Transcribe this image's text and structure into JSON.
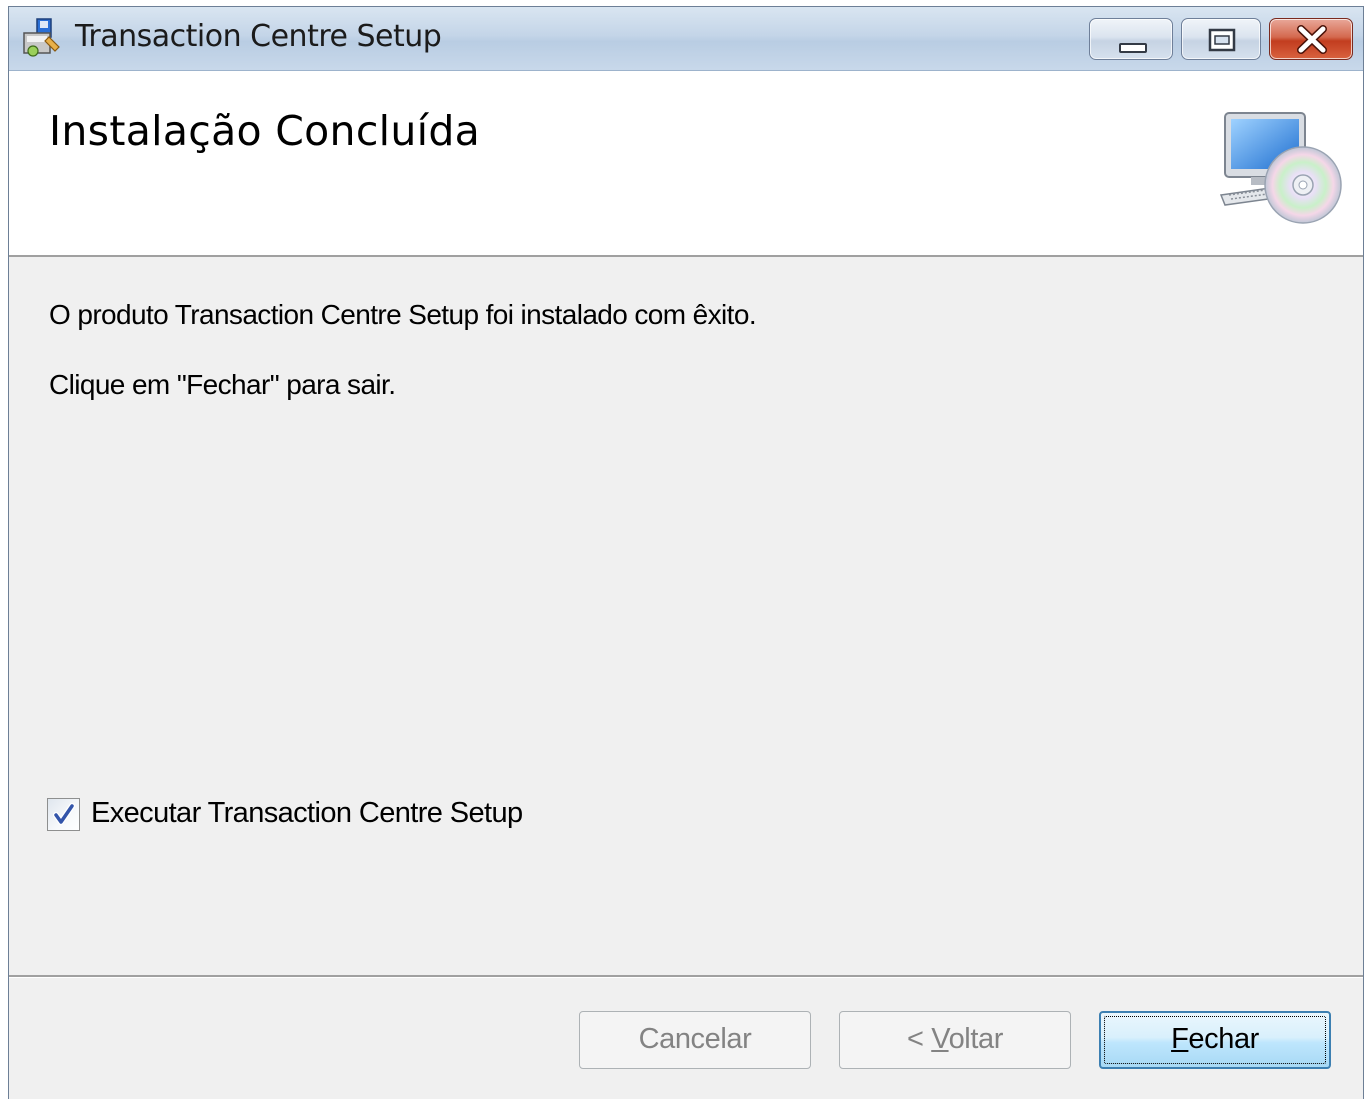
{
  "window": {
    "title": "Transaction Centre Setup"
  },
  "titlebar_buttons": {
    "minimize": "minimize-icon",
    "maximize": "maximize-icon",
    "close": "close-icon"
  },
  "banner": {
    "title": "Instalação Concluída",
    "icon": "computer-cd-setup-icon"
  },
  "body": {
    "message_1": "O produto Transaction Centre Setup foi instalado com êxito.",
    "message_2": "Clique em \"Fechar\" para sair.",
    "run_checkbox": {
      "label": "Executar Transaction Centre Setup",
      "checked": true
    }
  },
  "footer": {
    "cancel_label": "Cancelar",
    "back_prefix": "< ",
    "back_mnemonic": "V",
    "back_rest": "oltar",
    "close_mnemonic": "F",
    "close_rest": "echar"
  },
  "colors": {
    "accent": "#3c7fb1",
    "close_button": "#c23d1f",
    "disabled_text": "#838383"
  }
}
